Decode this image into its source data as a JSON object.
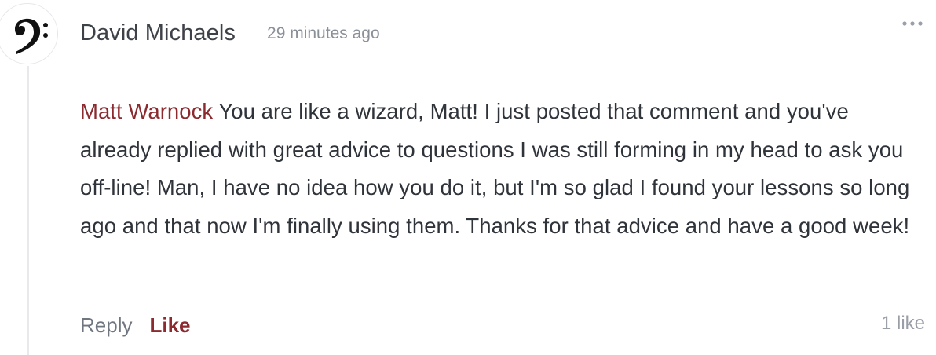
{
  "comment": {
    "author": "David Michaels",
    "timestamp": "29 minutes ago",
    "avatar_icon": "bass-clef-icon",
    "more_icon": "more-horizontal-icon",
    "mention": "Matt Warnock",
    "text": " You are like a wizard, Matt! I just posted that comment and you've already replied with great advice to questions I was still forming in my head to ask you off-line! Man, I have no idea how you do it, but I'm so glad I found your lessons so long ago and that now I'm finally using them. Thanks for that advice and have a good week!",
    "actions": {
      "reply_label": "Reply",
      "like_label": "Like"
    },
    "like_count": "1 like"
  },
  "colors": {
    "accent": "#8b2a2f",
    "author": "#3d4148",
    "muted": "#8a8f98",
    "body": "#2f333a",
    "thread_line": "#e8e9ed"
  }
}
